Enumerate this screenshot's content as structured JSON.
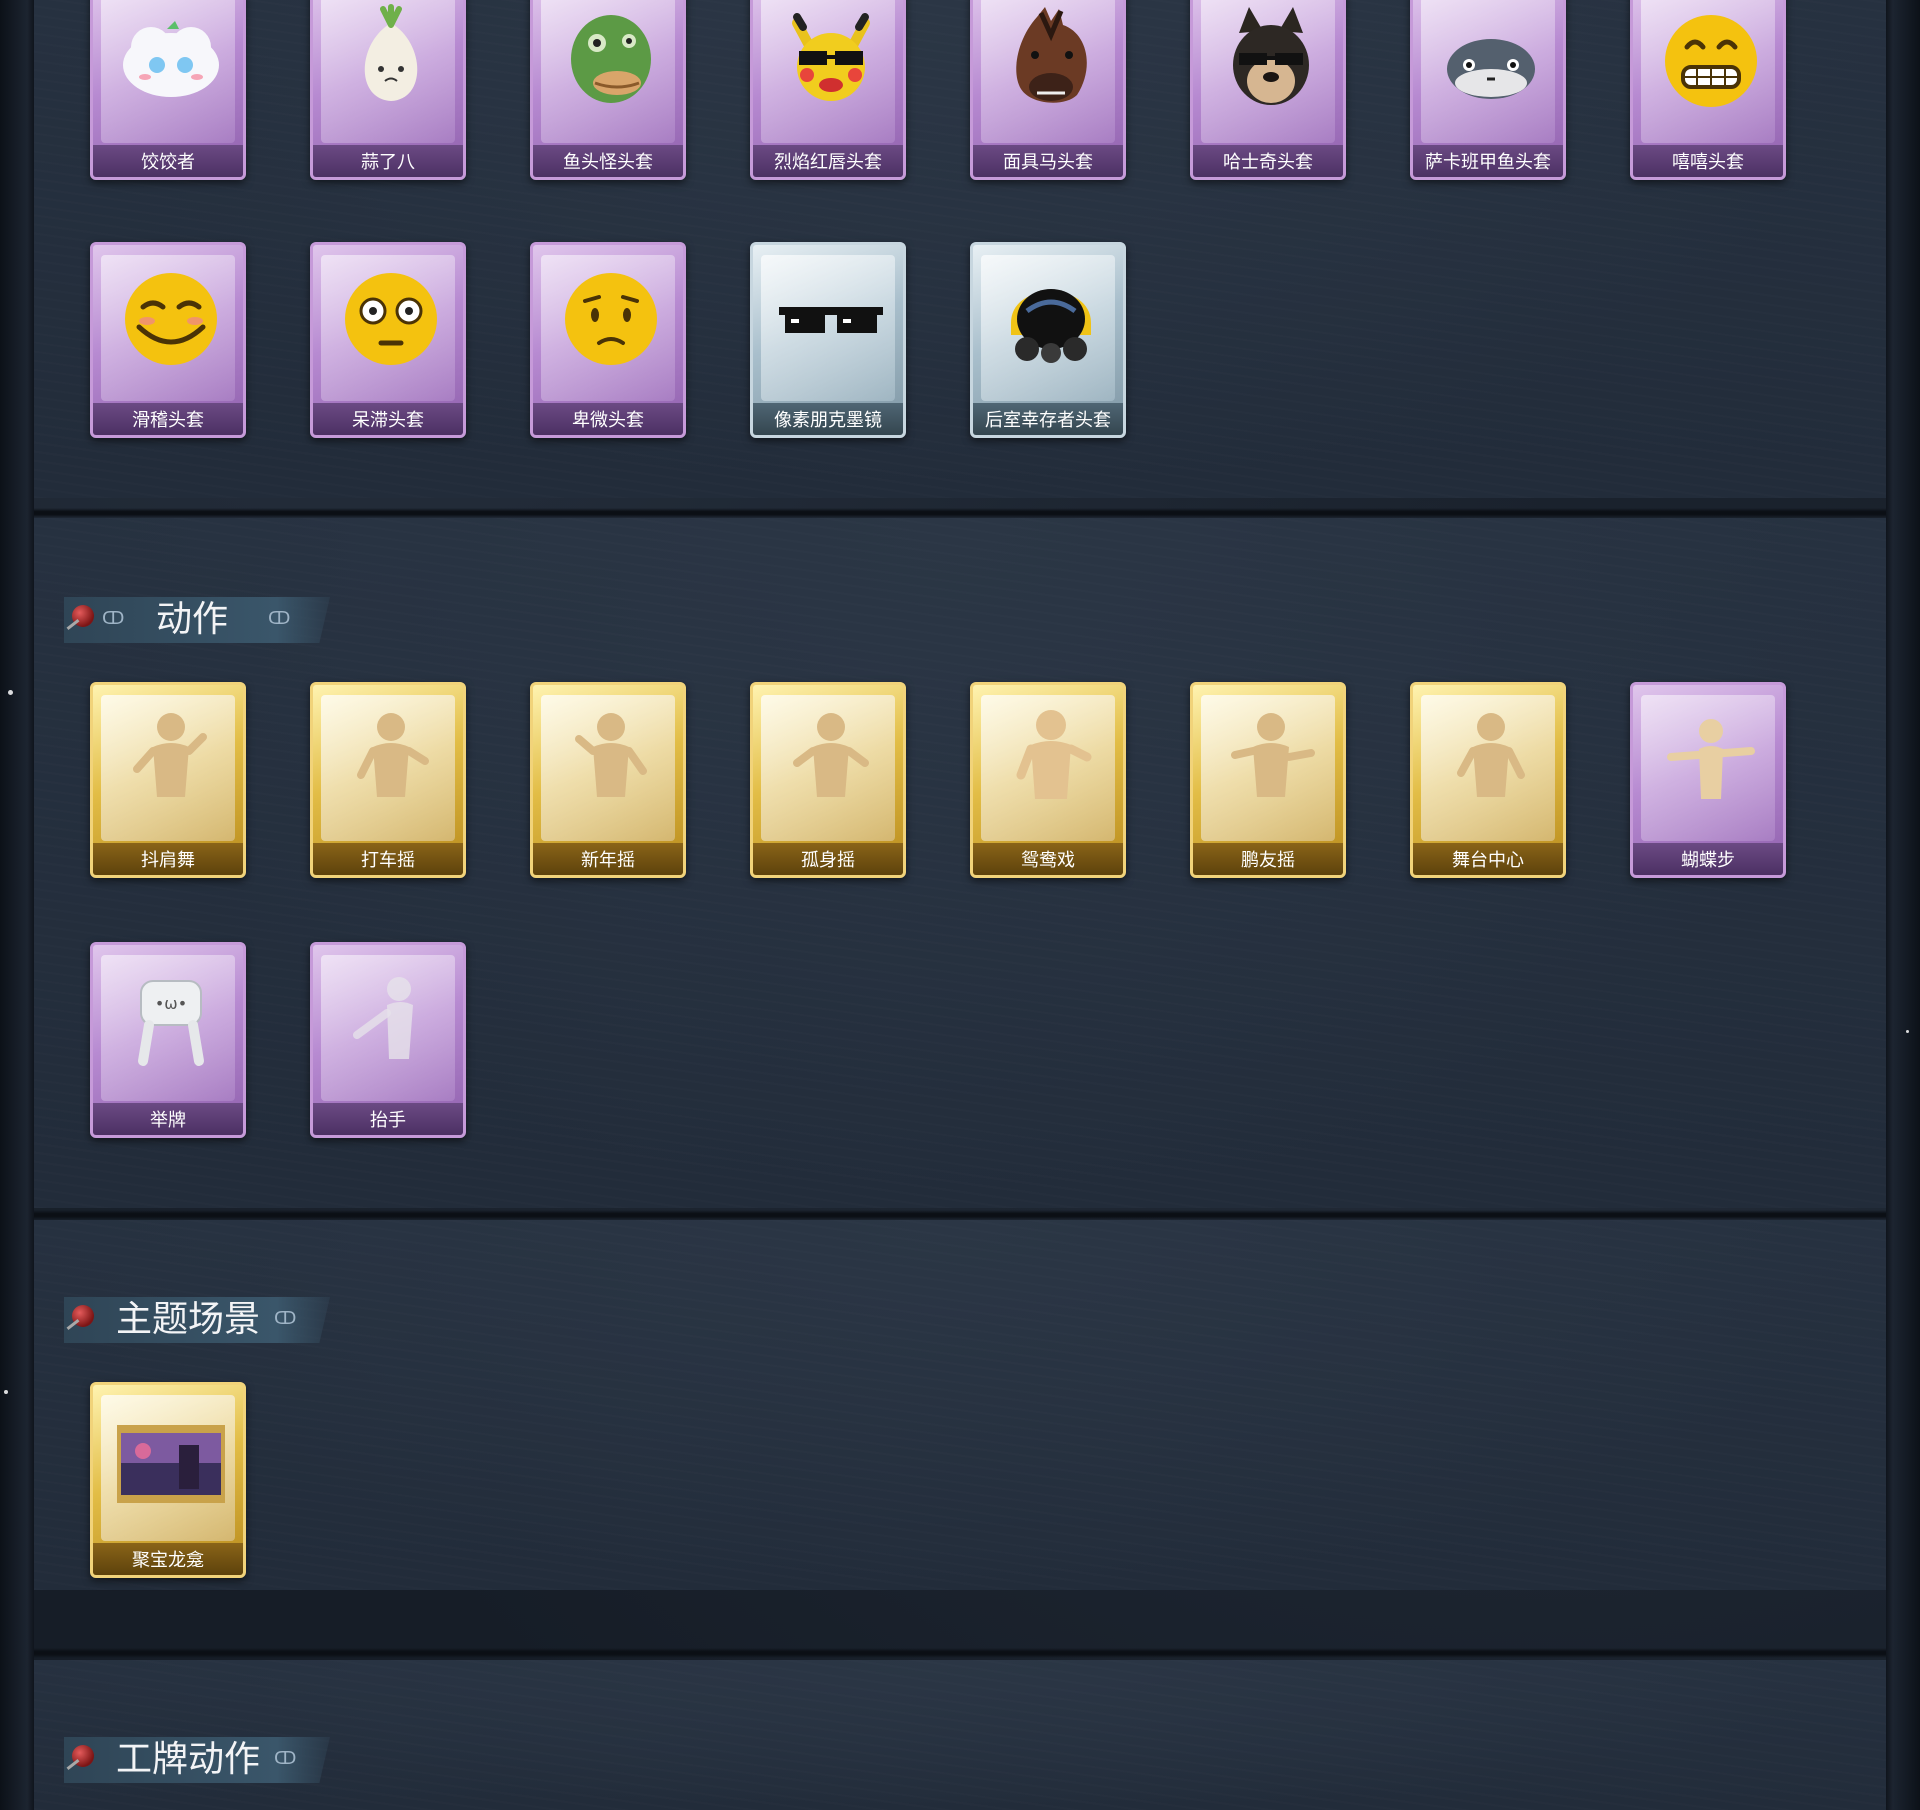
{
  "sections": {
    "actions_title": "动作",
    "theme_title": "主题场景",
    "badge_title": "工牌动作"
  },
  "headgear": [
    {
      "label": "饺饺者",
      "rarity": "purple",
      "icon": "dumpling-mascot-icon"
    },
    {
      "label": "蒜了八",
      "rarity": "purple",
      "icon": "garlic-mascot-icon"
    },
    {
      "label": "鱼头怪头套",
      "rarity": "purple",
      "icon": "fish-head-mask-icon"
    },
    {
      "label": "烈焰红唇头套",
      "rarity": "purple",
      "icon": "yellow-lips-mask-icon"
    },
    {
      "label": "面具马头套",
      "rarity": "purple",
      "icon": "horse-mask-icon"
    },
    {
      "label": "哈士奇头套",
      "rarity": "purple",
      "icon": "husky-mask-icon"
    },
    {
      "label": "萨卡班甲鱼头套",
      "rarity": "purple",
      "icon": "sacabambaspis-mask-icon"
    },
    {
      "label": "嘻嘻头套",
      "rarity": "purple",
      "icon": "grin-emoji-mask-icon"
    },
    {
      "label": "滑稽头套",
      "rarity": "purple",
      "icon": "smirk-emoji-mask-icon"
    },
    {
      "label": "呆滞头套",
      "rarity": "purple",
      "icon": "stare-emoji-mask-icon"
    },
    {
      "label": "卑微头套",
      "rarity": "purple",
      "icon": "humble-emoji-mask-icon"
    },
    {
      "label": "像素朋克墨镜",
      "rarity": "silver",
      "icon": "pixel-sunglasses-icon"
    },
    {
      "label": "后室幸存者头套",
      "rarity": "silver",
      "icon": "gas-mask-helmet-icon"
    }
  ],
  "actions": [
    {
      "label": "抖肩舞",
      "rarity": "gold",
      "icon": "dance-pose-icon"
    },
    {
      "label": "打车摇",
      "rarity": "gold",
      "icon": "dance-pose-icon"
    },
    {
      "label": "新年摇",
      "rarity": "gold",
      "icon": "dance-pose-icon"
    },
    {
      "label": "孤身摇",
      "rarity": "gold",
      "icon": "dance-pose-icon"
    },
    {
      "label": "鸳鸯戏",
      "rarity": "gold",
      "icon": "dance-pose-icon"
    },
    {
      "label": "鹏友摇",
      "rarity": "gold",
      "icon": "dance-pose-icon"
    },
    {
      "label": "舞台中心",
      "rarity": "gold",
      "icon": "dance-pose-icon"
    },
    {
      "label": "蝴蝶步",
      "rarity": "purple",
      "icon": "dance-pose-icon"
    },
    {
      "label": "举牌",
      "rarity": "purple",
      "icon": "sign-holding-icon"
    },
    {
      "label": "抬手",
      "rarity": "purple",
      "icon": "raise-hand-icon"
    }
  ],
  "themes": [
    {
      "label": "聚宝龙龛",
      "rarity": "gold",
      "icon": "scene-painting-icon"
    }
  ],
  "colors": {
    "background": "#161d27",
    "panel": "#263140",
    "gold_card": "#e2bd46",
    "purple_card": "#b78ad1",
    "silver_card": "#a9bfcc"
  }
}
